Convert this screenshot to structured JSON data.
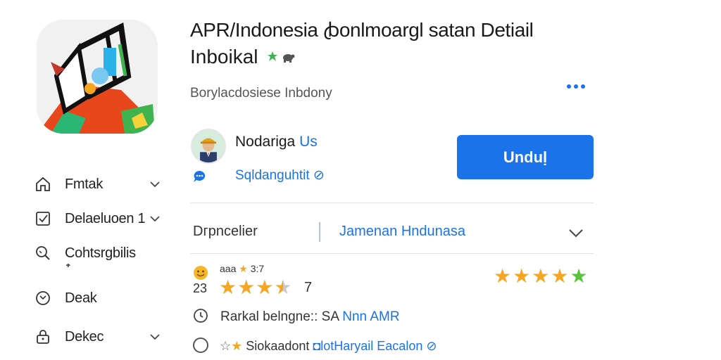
{
  "header": {
    "title_line1": "APR/Indonesia ꞗonlmoargl satan Detiail",
    "title_line2": "Inboikal",
    "subtitle": "Borylacdosiese Inbdony"
  },
  "developer": {
    "name": "Nodariga",
    "name_suffix": "Us",
    "link": "Sqldanguhtit ⊘"
  },
  "install_button": {
    "label": "Unduḷ"
  },
  "filter": {
    "label": "Dгрncelier",
    "value": "Jamenan Hndunasa"
  },
  "ratings": {
    "mini_text": "aaa",
    "mini_star": "★",
    "mini_value": "3:7",
    "count_icon": "23",
    "big_stars": [
      "on",
      "on",
      "on",
      "half",
      "off"
    ],
    "count": "7",
    "right_stars": [
      "on",
      "on",
      "on",
      "on",
      "green"
    ]
  },
  "info_rows": [
    {
      "text": "Rarkal belngne:: SA",
      "link": "Nnn AMR"
    },
    {
      "star_outline": "☆",
      "star_filled": "★",
      "text": "Siokaadont",
      "link": "◘lotHaryail Eacalon ⊘"
    }
  ],
  "sidebar": {
    "items": [
      {
        "label": "Fmtak",
        "icon": "home-icon",
        "has_chevron": true
      },
      {
        "label": "Delaeluoen 1",
        "icon": "checkbox-icon",
        "has_chevron": true
      },
      {
        "label": "Cohtsrgbilis",
        "icon": "search-icon",
        "has_chevron": false
      },
      {
        "label": "Deak",
        "icon": "smile-icon",
        "has_chevron": false
      },
      {
        "label": "Dekec",
        "icon": "lock-icon",
        "has_chevron": true
      }
    ],
    "sub_marker": "᛭"
  },
  "colors": {
    "accent": "#1a73e8",
    "star": "#f5a623",
    "star_green": "#5ac43a"
  }
}
